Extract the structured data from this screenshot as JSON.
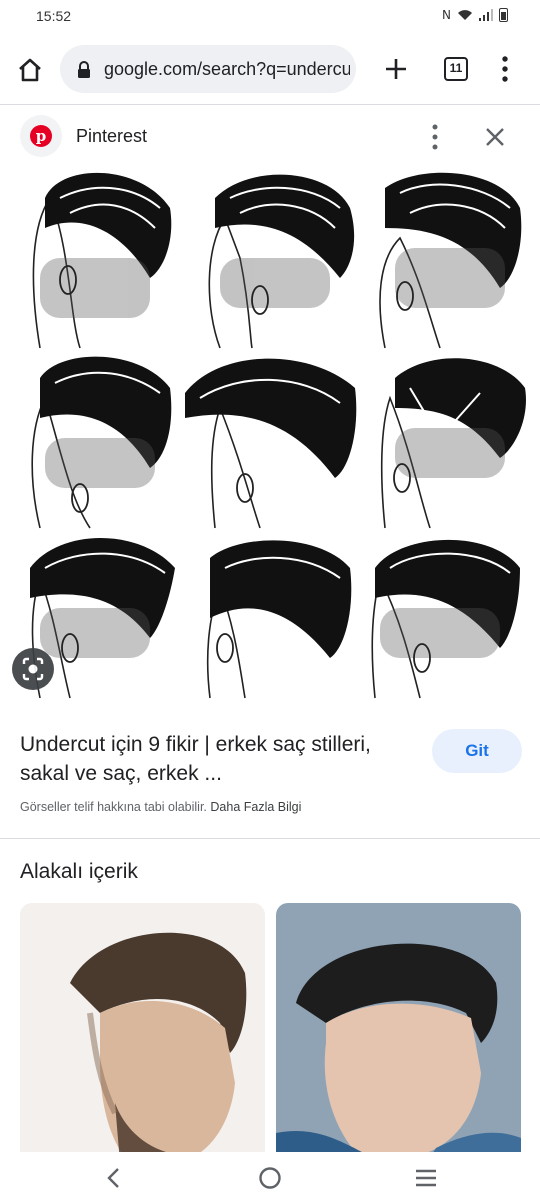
{
  "status": {
    "time": "15:52",
    "nfc_symbol": "N"
  },
  "toolbar": {
    "url": "google.com/search?q=undercut",
    "tab_count": "11"
  },
  "source": {
    "name": "Pinterest",
    "logo_letter": "p"
  },
  "result": {
    "title": "Undercut için 9 fikir | erkek saç stilleri, sakal ve saç, erkek ...",
    "visit_label": "Git",
    "copyright_text": "Görseller telif hakkına tabi olabilir.",
    "more_info_link": "Daha Fazla Bilgi"
  },
  "related": {
    "heading": "Alakalı içerik"
  },
  "colors": {
    "accent": "#1a73e8",
    "button_bg": "#e8f0fe",
    "pinterest_red": "#e60023",
    "url_bar_bg": "#eef0f3"
  }
}
